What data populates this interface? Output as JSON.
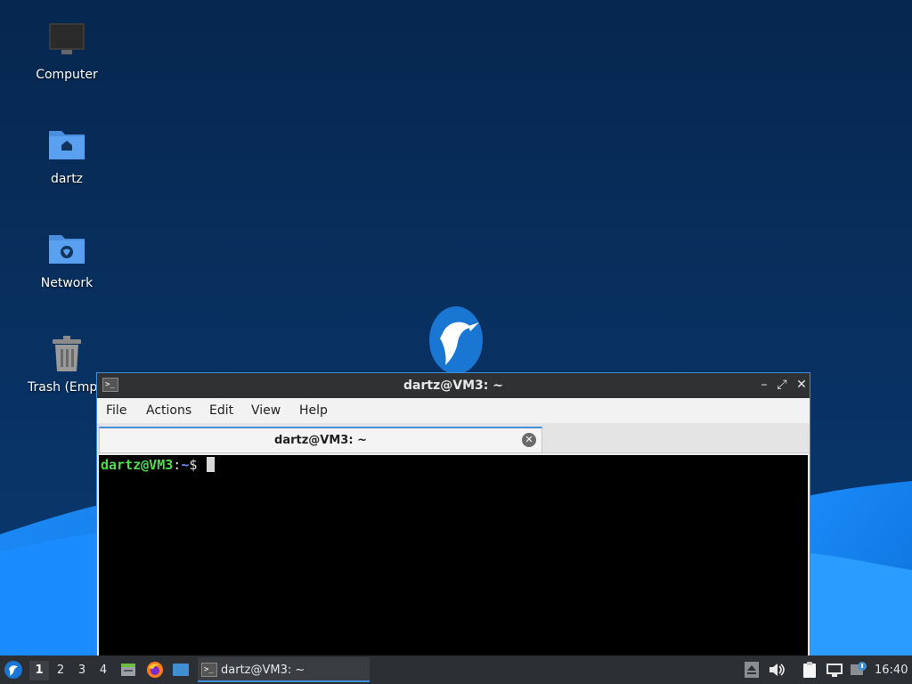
{
  "desktop": {
    "icons": [
      {
        "label": "Computer"
      },
      {
        "label": "dartz"
      },
      {
        "label": "Network"
      },
      {
        "label": "Trash (Empty)"
      }
    ]
  },
  "terminal": {
    "window_title": "dartz@VM3: ~",
    "menu": [
      "File",
      "Actions",
      "Edit",
      "View",
      "Help"
    ],
    "tab_label": "dartz@VM3: ~",
    "prompt_user_host": "dartz@VM3",
    "prompt_colon": ":",
    "prompt_path": "~",
    "prompt_symbol": "$",
    "window_buttons": {
      "minimize": "–",
      "maximize": "⤢",
      "close": "✕"
    }
  },
  "taskbar": {
    "workspaces": [
      "1",
      "2",
      "3",
      "4"
    ],
    "active_workspace": "1",
    "task_label": "dartz@VM3: ~",
    "clock": "16:40",
    "launchers": [
      "file-manager-icon",
      "firefox-icon",
      "show-desktop-icon"
    ],
    "tray_icons": [
      "eject-icon",
      "volume-icon",
      "clipboard-icon",
      "network-icon",
      "update-notifier-icon"
    ]
  },
  "colors": {
    "desktop_bg": "#062b57",
    "accent": "#3f8ed6",
    "prompt_user": "#4edc4e",
    "prompt_path": "#6c8cff"
  }
}
